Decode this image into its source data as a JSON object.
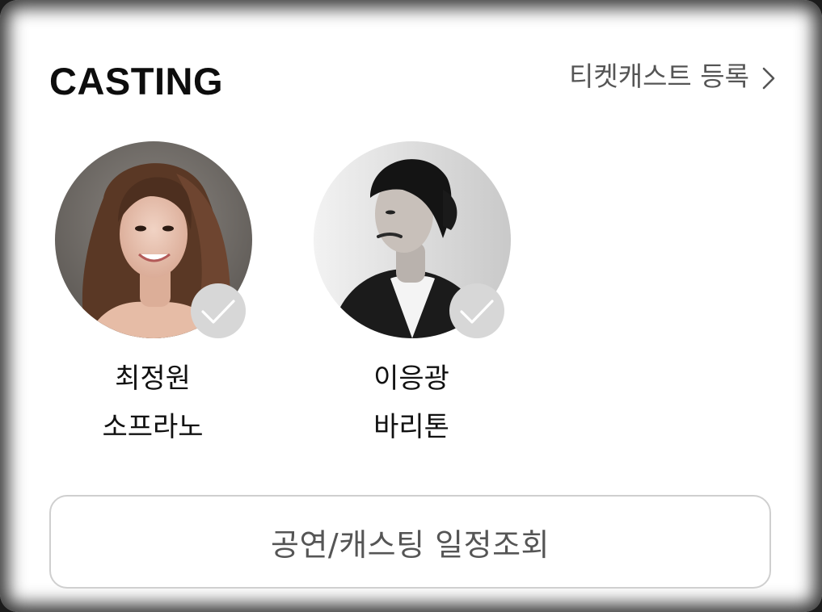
{
  "section": {
    "title": "CASTING",
    "ticketcast_link_label": "티켓캐스트 등록",
    "link_icon": "chevron-right-icon"
  },
  "cast": [
    {
      "name": "최정원",
      "role": "소프라노",
      "photo": "photo-portrait-woman-color",
      "checked_icon": "check-icon"
    },
    {
      "name": "이응광",
      "role": "바리톤",
      "photo": "photo-portrait-man-bw",
      "checked_icon": "check-icon"
    }
  ],
  "schedule_button_label": "공연/캐스팅 일정조회",
  "colors": {
    "title": "#0d0d0d",
    "link": "#555555",
    "badge": "#d7d7d7",
    "button_border": "#cfcfcf",
    "button_text": "#555555"
  }
}
